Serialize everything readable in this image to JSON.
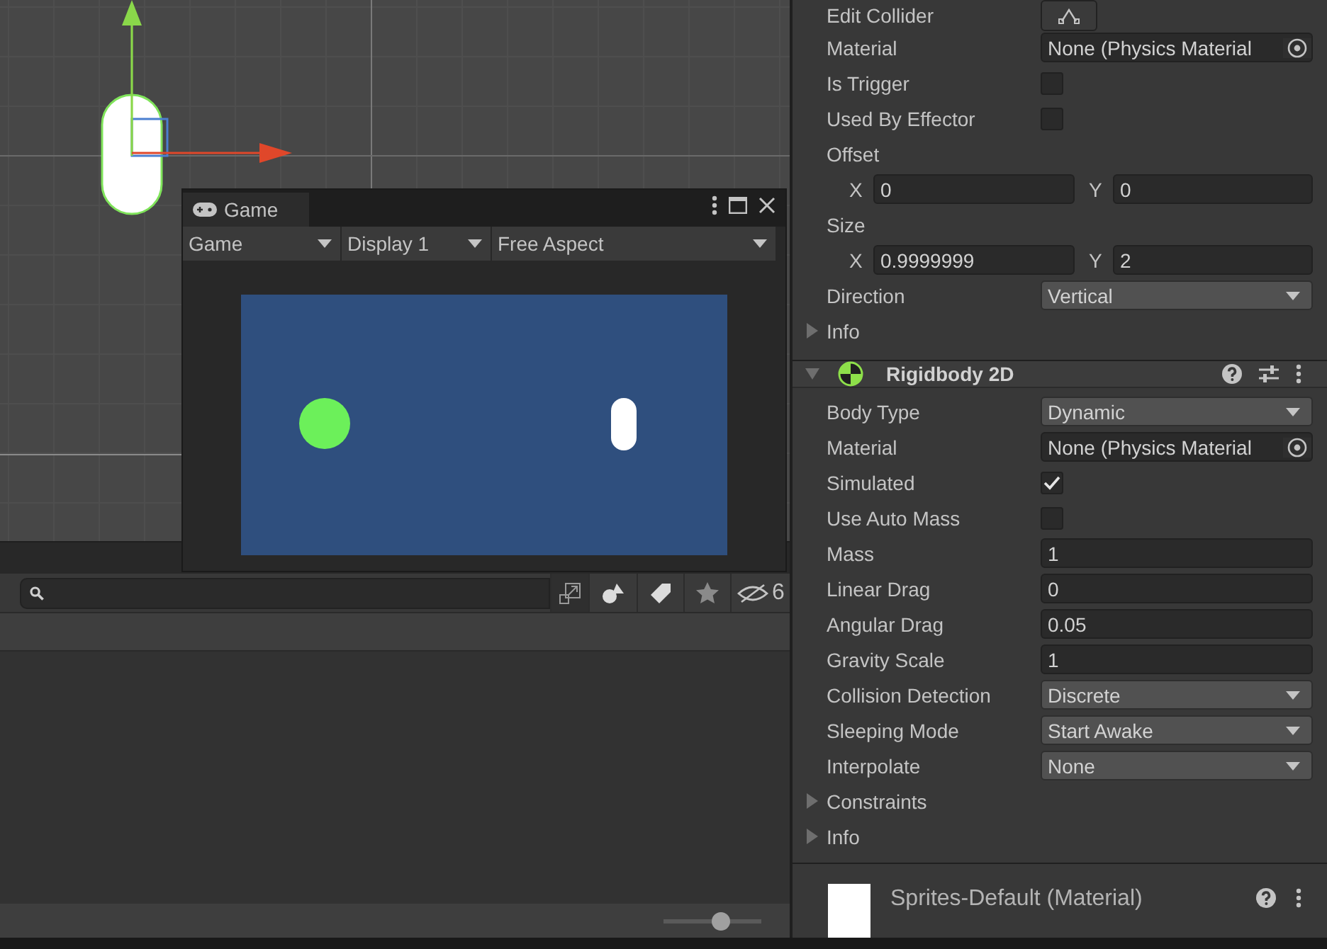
{
  "game_window": {
    "tab": "Game",
    "toolbar": [
      {
        "label": "Game"
      },
      {
        "label": "Display 1"
      },
      {
        "label": "Free Aspect"
      }
    ]
  },
  "project_toolbar": {
    "hidden_count": "6"
  },
  "bottom_bar": {
    "zoom_slider": {
      "level": 0.58
    }
  },
  "inspector": {
    "collider": {
      "rows": [
        {
          "kind": "button",
          "label": "Edit Collider"
        },
        {
          "kind": "object",
          "label": "Material",
          "value": "None (Physics Material"
        },
        {
          "kind": "checkbox",
          "label": "Is Trigger",
          "checked": false
        },
        {
          "kind": "checkbox",
          "label": "Used By Effector",
          "checked": false
        },
        {
          "kind": "heading",
          "label": "Offset"
        },
        {
          "kind": "vector",
          "fields": [
            {
              "axis": "X",
              "value": "0"
            },
            {
              "axis": "Y",
              "value": "0"
            }
          ]
        },
        {
          "kind": "heading",
          "label": "Size"
        },
        {
          "kind": "vector",
          "fields": [
            {
              "axis": "X",
              "value": "0.9999999"
            },
            {
              "axis": "Y",
              "value": "2"
            }
          ]
        },
        {
          "kind": "dropdown",
          "label": "Direction",
          "value": "Vertical"
        },
        {
          "kind": "foldout",
          "label": "Info",
          "expanded": false
        }
      ]
    },
    "rigidbody": {
      "title": "Rigidbody 2D",
      "expanded": true,
      "rows": [
        {
          "kind": "dropdown",
          "label": "Body Type",
          "value": "Dynamic"
        },
        {
          "kind": "object",
          "label": "Material",
          "value": "None (Physics Material"
        },
        {
          "kind": "checkbox",
          "label": "Simulated",
          "checked": true
        },
        {
          "kind": "checkbox",
          "label": "Use Auto Mass",
          "checked": false
        },
        {
          "kind": "number",
          "label": "Mass",
          "value": "1"
        },
        {
          "kind": "number",
          "label": "Linear Drag",
          "value": "0"
        },
        {
          "kind": "number",
          "label": "Angular Drag",
          "value": "0.05"
        },
        {
          "kind": "number",
          "label": "Gravity Scale",
          "value": "1"
        },
        {
          "kind": "dropdown",
          "label": "Collision Detection",
          "value": "Discrete"
        },
        {
          "kind": "dropdown",
          "label": "Sleeping Mode",
          "value": "Start Awake"
        },
        {
          "kind": "dropdown",
          "label": "Interpolate",
          "value": "None"
        },
        {
          "kind": "foldout",
          "label": "Constraints",
          "expanded": false
        },
        {
          "kind": "foldout",
          "label": "Info",
          "expanded": false
        }
      ]
    },
    "material": {
      "title": "Sprites-Default (Material)"
    }
  }
}
